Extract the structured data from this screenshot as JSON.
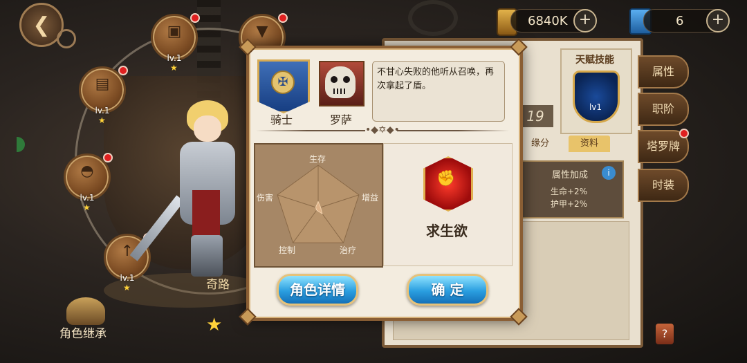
{
  "currency": {
    "gold_amount": "6840K",
    "gem_amount": "6",
    "plus_glyph": "+"
  },
  "equipment_slots": [
    {
      "level": "lv.1",
      "icon": "boots-icon",
      "glyph": "▣"
    },
    {
      "level": "",
      "icon": "gauntlet-icon",
      "glyph": "▼"
    },
    {
      "level": "lv.1",
      "icon": "armor-icon",
      "glyph": "▤"
    },
    {
      "level": "lv.1",
      "icon": "helmet-icon",
      "glyph": "◓"
    },
    {
      "level": "lv.1",
      "icon": "spear-icon",
      "glyph": "↑"
    }
  ],
  "left": {
    "path_label": "奇路",
    "inherit_label": "角色继承",
    "star_glyph": "★"
  },
  "right_panel": {
    "talent_title": "天赋技能",
    "talent_level": "lv1",
    "number_19": "19",
    "tab_bond": "缘分",
    "tab_profile": "资料",
    "attr_title": "属性加成",
    "attr_line1": "生命+2%",
    "attr_line2": "护甲+2%",
    "info_glyph": "i",
    "help_glyph": "?"
  },
  "side_tabs": [
    "属性",
    "职阶",
    "塔罗牌",
    "时装"
  ],
  "popup": {
    "class_label": "骑士",
    "name_label": "罗萨",
    "description": "不甘心失败的他听从召唤，再次拿起了盾。",
    "divider_ornament": "•◆✡◆•",
    "radar_axes": [
      "生存",
      "增益",
      "治疗",
      "控制",
      "伤害"
    ],
    "radar_values": [
      0.15,
      0.0,
      0.0,
      0.0,
      0.0
    ],
    "skill_name": "求生欲",
    "skill_icon": "fist-icon",
    "skill_glyph": "✊",
    "detail_button": "角色详情",
    "confirm_button": "确 定"
  },
  "colors": {
    "accent_blue": "#2a9ee0",
    "frame_brown": "#8a5e34",
    "radar_fill": "#a68766"
  }
}
